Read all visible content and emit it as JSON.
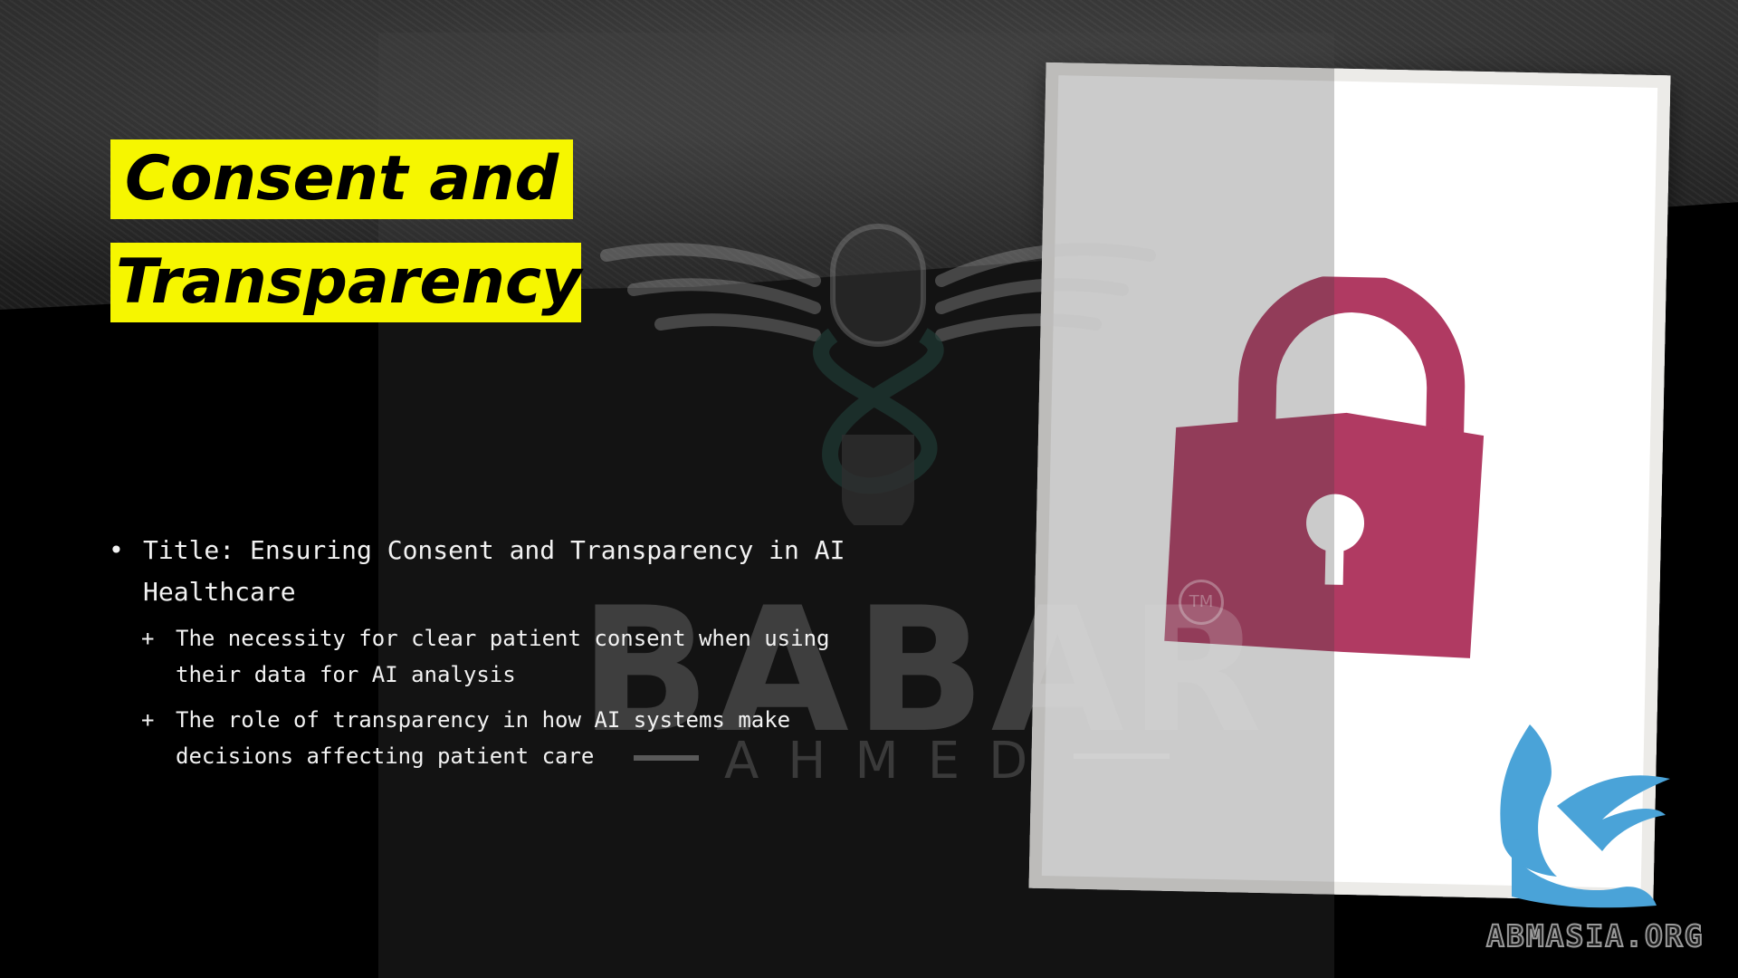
{
  "slide": {
    "title_line1": "Consent and",
    "title_line2": "Transparency",
    "bullet_main": "Title: Ensuring Consent and Transparency in AI Healthcare",
    "sub_bullets": [
      "The necessity for clear patient consent when using their data for AI analysis",
      "The role of transparency in how AI systems make decisions affecting patient care"
    ],
    "bullet_mark": "•",
    "sub_bullet_mark": "+"
  },
  "watermark": {
    "logo_word": "BABAR",
    "logo_sub": "AHMED",
    "logo_tm": "TM"
  },
  "image": {
    "icon": "padlock-icon",
    "lock_color": "#b03a62"
  },
  "brand": {
    "text": "ABMASIA.ORG",
    "icon": "griffin-icon",
    "color": "#4aa3d8"
  },
  "colors": {
    "title_highlight": "#f6f600",
    "background": "#000000"
  }
}
